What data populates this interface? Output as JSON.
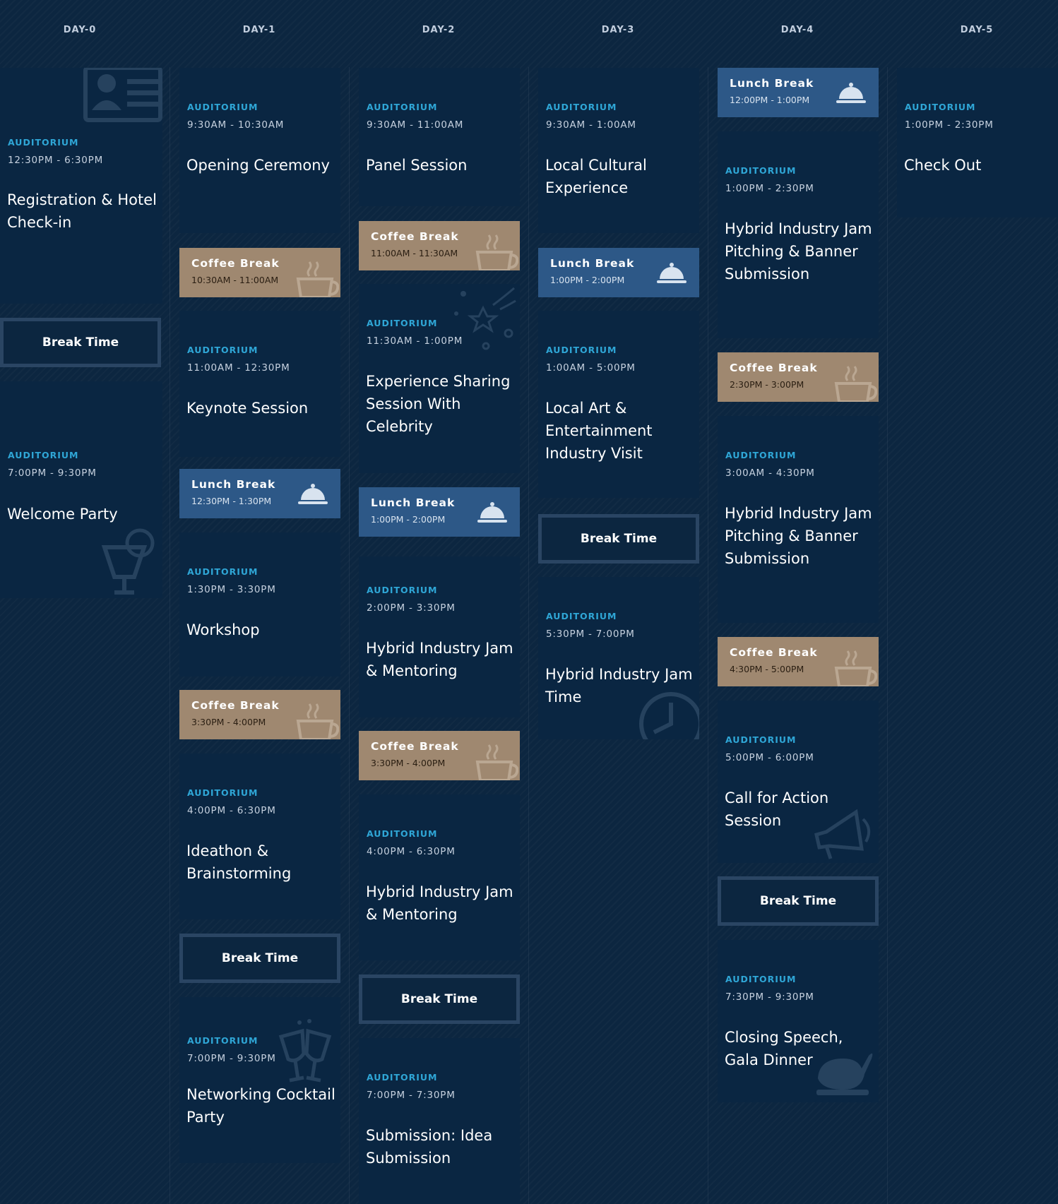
{
  "days": [
    {
      "header": "DAY-0",
      "events": [
        {
          "label": "AUDITORIUM",
          "time": "12:30PM - 6:30PM",
          "title": "Registration & Hotel Check-in"
        },
        {
          "label": "AUDITORIUM",
          "time": "7:00PM - 9:30PM",
          "title": "Welcome Party"
        }
      ],
      "breaks": [
        {
          "label": "Break Time"
        }
      ]
    },
    {
      "header": "DAY-1",
      "events": [
        {
          "label": "AUDITORIUM",
          "time": "9:30AM - 10:30AM",
          "title": "Opening Ceremony"
        },
        {
          "label": "AUDITORIUM",
          "time": "11:00AM - 12:30PM",
          "title": "Keynote Session"
        },
        {
          "label": "AUDITORIUM",
          "time": "1:30PM - 3:30PM",
          "title": "Workshop"
        },
        {
          "label": "AUDITORIUM",
          "time": "4:00PM - 6:30PM",
          "title": "Ideathon & Brainstorming"
        },
        {
          "label": "AUDITORIUM",
          "time": "7:00PM - 9:30PM",
          "title": "Networking Cocktail Party"
        }
      ],
      "breaks": [
        {
          "title": "Coffee Break",
          "time": "10:30AM - 11:00AM"
        },
        {
          "title": "Lunch Break",
          "time": "12:30PM - 1:30PM"
        },
        {
          "title": "Coffee Break",
          "time": "3:30PM - 4:00PM"
        },
        {
          "label": "Break Time"
        }
      ]
    },
    {
      "header": "DAY-2",
      "events": [
        {
          "label": "AUDITORIUM",
          "time": "9:30AM - 11:00AM",
          "title": "Panel Session"
        },
        {
          "label": "AUDITORIUM",
          "time": "11:30AM - 1:00PM",
          "title": "Experience Sharing Session With Celebrity"
        },
        {
          "label": "AUDITORIUM",
          "time": "2:00PM - 3:30PM",
          "title": "Hybrid Industry Jam & Mentoring"
        },
        {
          "label": "AUDITORIUM",
          "time": "4:00PM - 6:30PM",
          "title": "Hybrid Industry Jam & Mentoring"
        },
        {
          "label": "AUDITORIUM",
          "time": "7:00PM - 7:30PM",
          "title": "Submission: Idea Submission"
        }
      ],
      "breaks": [
        {
          "title": "Coffee Break",
          "time": "11:00AM - 11:30AM"
        },
        {
          "title": "Lunch Break",
          "time": "1:00PM - 2:00PM"
        },
        {
          "title": "Coffee Break",
          "time": "3:30PM - 4:00PM"
        },
        {
          "label": "Break Time"
        }
      ]
    },
    {
      "header": "DAY-3",
      "events": [
        {
          "label": "AUDITORIUM",
          "time": "9:30AM - 1:00AM",
          "title": "Local Cultural Experience"
        },
        {
          "label": "AUDITORIUM",
          "time": "1:00AM - 5:00PM",
          "title": "Local Art & Entertainment Industry Visit"
        },
        {
          "label": "AUDITORIUM",
          "time": "5:30PM - 7:00PM",
          "title": "Hybrid Industry Jam Time"
        }
      ],
      "breaks": [
        {
          "title": "Lunch Break",
          "time": "1:00PM - 2:00PM"
        },
        {
          "label": "Break Time"
        }
      ]
    },
    {
      "header": "DAY-4",
      "events": [
        {
          "label": "AUDITORIUM",
          "time": "1:00PM - 2:30PM",
          "title": "Hybrid Industry Jam Pitching & Banner Submission"
        },
        {
          "label": "AUDITORIUM",
          "time": "3:00AM - 4:30PM",
          "title": "Hybrid Industry Jam Pitching & Banner Submission"
        },
        {
          "label": "AUDITORIUM",
          "time": "5:00PM - 6:00PM",
          "title": "Call for Action Session"
        },
        {
          "label": "AUDITORIUM",
          "time": "7:30PM - 9:30PM",
          "title": "Closing Speech, Gala Dinner"
        }
      ],
      "breaks": [
        {
          "title": "Lunch Break",
          "time": "12:00PM - 1:00PM"
        },
        {
          "title": "Coffee Break",
          "time": "2:30PM - 3:00PM"
        },
        {
          "title": "Coffee Break",
          "time": "4:30PM - 5:00PM"
        },
        {
          "label": "Break Time"
        }
      ]
    },
    {
      "header": "DAY-5",
      "events": [
        {
          "label": "AUDITORIUM",
          "time": "1:00PM - 2:30PM",
          "title": "Check Out"
        }
      ],
      "breaks": []
    }
  ],
  "colors": {
    "background": "#0c2640",
    "card": "#0a2642",
    "accent": "#2fa6d6",
    "coffee": "#9f8870",
    "lunch": "#2d5887",
    "breaktime_border": "#2a4563"
  },
  "icons": [
    "id-card-icon",
    "cocktail-icon",
    "coffee-cup-icon",
    "cloche-icon",
    "fireworks-icon",
    "clock-icon",
    "megaphone-icon",
    "champagne-toast-icon",
    "roast-turkey-icon"
  ]
}
